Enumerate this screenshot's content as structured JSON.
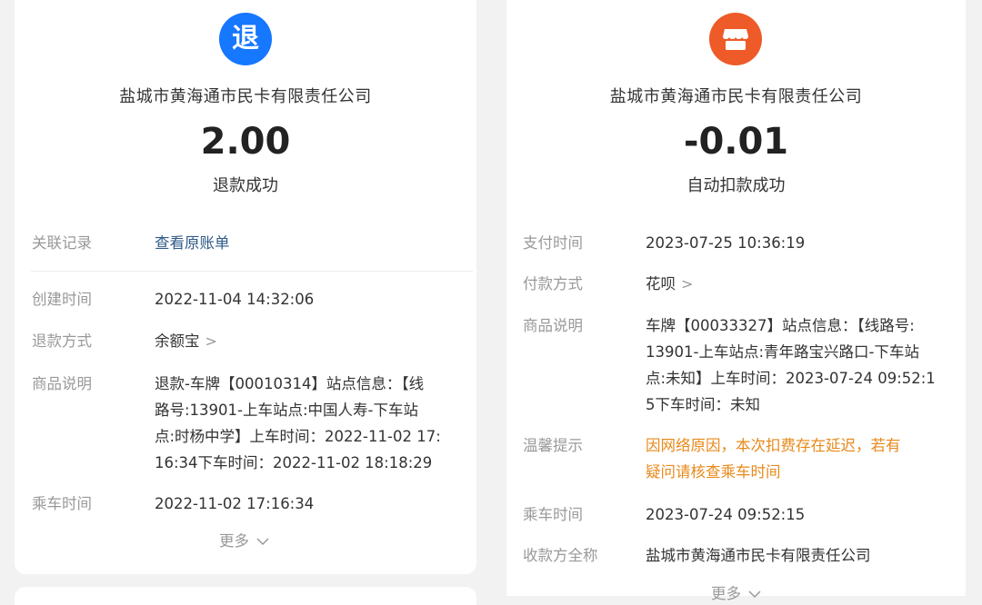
{
  "left": {
    "logo_text": "退",
    "merchant": "盐城市黄海通市民卡有限责任公司",
    "amount": "2.00",
    "status": "退款成功",
    "related_label": "关联记录",
    "related_link": "查看原账单",
    "rows": [
      {
        "label": "创建时间",
        "value": "2022-11-04 14:32:06"
      },
      {
        "label": "退款方式",
        "value": "余额宝"
      },
      {
        "label": "商品说明",
        "lines": [
          "退款-车牌【00010314】站点信息：【线",
          "路号:13901-上车站点:中国人寿-下车站",
          "点:时杨中学】上车时间：2022-11-02 17:",
          "16:34下车时间：2022-11-02 18:18:29"
        ]
      },
      {
        "label": "乘车时间",
        "value": "2022-11-02 17:16:34"
      }
    ],
    "more": "更多"
  },
  "right": {
    "logo_icon": "shop-icon",
    "merchant": "盐城市黄海通市民卡有限责任公司",
    "amount": "-0.01",
    "status": "自动扣款成功",
    "rows": [
      {
        "label": "支付时间",
        "value": "2023-07-25 10:36:19"
      },
      {
        "label": "付款方式",
        "value": "花呗"
      },
      {
        "label": "商品说明",
        "lines": [
          "车牌【00033327】站点信息：【线路号:",
          "13901-上车站点:青年路宝兴路口-下车站",
          "点:未知】上车时间：2023-07-24 09:52:1",
          "5下车时间：未知"
        ]
      },
      {
        "label": "温馨提示",
        "lines": [
          "因网络原因，本次扣费存在延迟，若有",
          "疑问请核查乘车时间"
        ]
      },
      {
        "label": "乘车时间",
        "value": "2023-07-24 09:52:15"
      },
      {
        "label": "收款方全称",
        "value": "盐城市黄海通市民卡有限责任公司"
      }
    ],
    "more": "更多"
  },
  "colors": {
    "refund_logo": "#1677ff",
    "shop_logo": "#ee5a28",
    "link": "#2e5a88",
    "warning": "#e8891a"
  }
}
